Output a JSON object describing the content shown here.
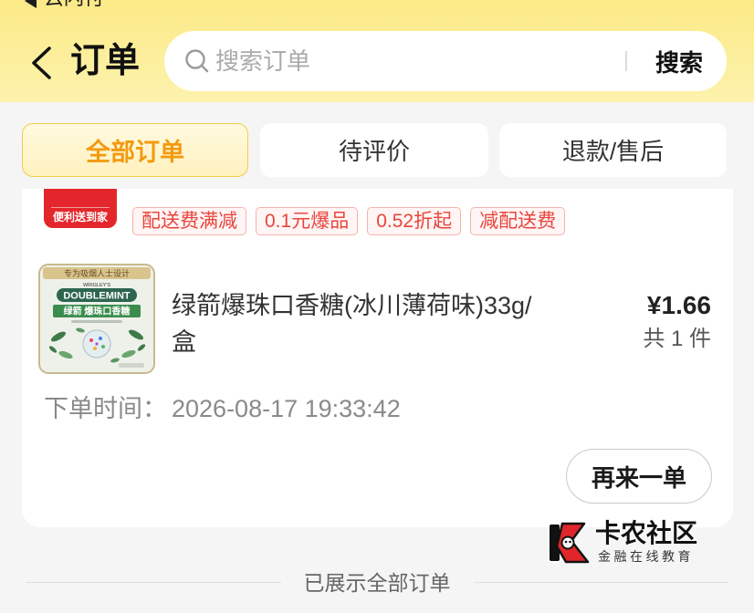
{
  "status_bar": {
    "back_icon": "back-triangle-icon",
    "back_app_label": "云闪付"
  },
  "header": {
    "back_icon": "chevron-left-icon",
    "title": "订单"
  },
  "search": {
    "icon": "search-icon",
    "placeholder": "搜索订单",
    "button_label": "搜索"
  },
  "tabs": [
    {
      "label": "全部订单",
      "active": true
    },
    {
      "label": "待评价",
      "active": false
    },
    {
      "label": "退款/售后",
      "active": false
    }
  ],
  "order": {
    "store_logo_text": "便利送到家",
    "tags": [
      "配送费满减",
      "0.1元爆品",
      "0.52折起",
      "减配送费"
    ],
    "product": {
      "name": "绿箭爆珠口香糖(冰川薄荷味)33g/盒",
      "price": "¥1.66",
      "quantity": "共 1 件",
      "image_text": {
        "top_band": "专为吸烟人士设计",
        "brand_small": "WRIGLEY'S",
        "brand": "DOUBLEMINT",
        "banner": "绿箭 爆珠口香糖"
      }
    },
    "time_label": "下单时间：",
    "time_value": "2026-08-17 19:33:42",
    "reorder_label": "再来一单"
  },
  "footer": {
    "end_text": "已展示全部订单"
  },
  "watermark": {
    "icon": "kanong-logo-icon",
    "title": "卡农社区",
    "subtitle": "金融在线教育"
  },
  "theme": {
    "header_yellow_top": "#fbea86",
    "header_yellow_bottom": "#fdf2ae",
    "accent_orange": "#f39a10",
    "tag_red": "#e8453c",
    "store_red": "#e3262b",
    "page_background": "#f5f5f5"
  }
}
